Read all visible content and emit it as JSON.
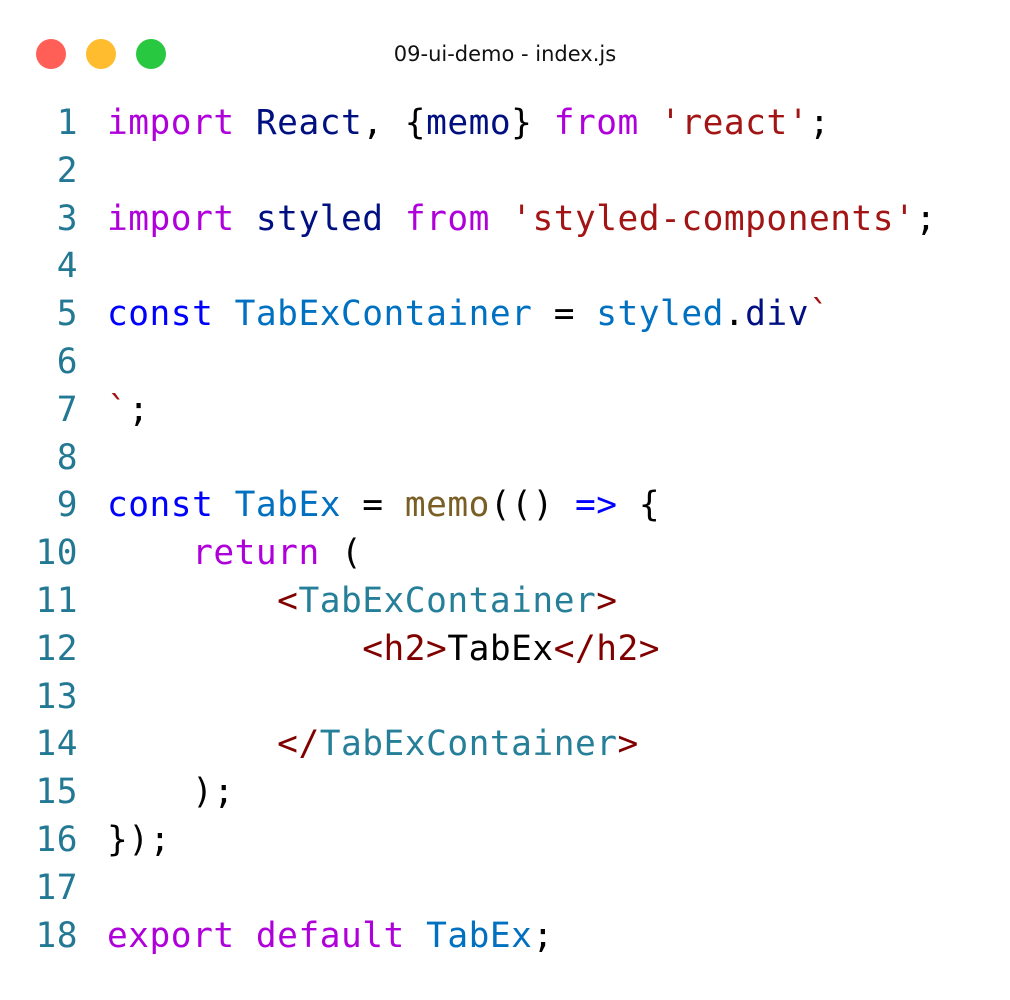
{
  "window": {
    "title": "09-ui-demo - index.js",
    "controls": {
      "close_color": "#ff5f57",
      "minimize_color": "#febc2e",
      "maximize_color": "#28c840"
    }
  },
  "theme": {
    "line_number": "#237893",
    "keyword": "#af00db",
    "storage": "#0000ff",
    "identifier": "#001080",
    "type": "#267f99",
    "string": "#a31515",
    "tag": "#800000",
    "function": "#795e26",
    "property": "#001080",
    "plain": "#000000"
  },
  "editor": {
    "lines": [
      {
        "number": "1",
        "tokens": [
          {
            "text": "import",
            "color": "#af00db"
          },
          {
            "text": " ",
            "color": "#000000"
          },
          {
            "text": "React",
            "color": "#001080"
          },
          {
            "text": ", {",
            "color": "#000000"
          },
          {
            "text": "memo",
            "color": "#001080"
          },
          {
            "text": "} ",
            "color": "#000000"
          },
          {
            "text": "from",
            "color": "#af00db"
          },
          {
            "text": " ",
            "color": "#000000"
          },
          {
            "text": "'react'",
            "color": "#a31515"
          },
          {
            "text": ";",
            "color": "#000000"
          }
        ]
      },
      {
        "number": "2",
        "tokens": []
      },
      {
        "number": "3",
        "tokens": [
          {
            "text": "import",
            "color": "#af00db"
          },
          {
            "text": " ",
            "color": "#000000"
          },
          {
            "text": "styled",
            "color": "#001080"
          },
          {
            "text": " ",
            "color": "#000000"
          },
          {
            "text": "from",
            "color": "#af00db"
          },
          {
            "text": " ",
            "color": "#000000"
          },
          {
            "text": "'styled-components'",
            "color": "#a31515"
          },
          {
            "text": ";",
            "color": "#000000"
          }
        ]
      },
      {
        "number": "4",
        "tokens": []
      },
      {
        "number": "5",
        "tokens": [
          {
            "text": "const",
            "color": "#0000ff"
          },
          {
            "text": " ",
            "color": "#000000"
          },
          {
            "text": "TabExContainer",
            "color": "#0070c1"
          },
          {
            "text": " = ",
            "color": "#000000"
          },
          {
            "text": "styled",
            "color": "#0070c1"
          },
          {
            "text": ".",
            "color": "#000000"
          },
          {
            "text": "div",
            "color": "#001080"
          },
          {
            "text": "`",
            "color": "#a31515"
          }
        ]
      },
      {
        "number": "6",
        "tokens": []
      },
      {
        "number": "7",
        "tokens": [
          {
            "text": "`",
            "color": "#a31515"
          },
          {
            "text": ";",
            "color": "#000000"
          }
        ]
      },
      {
        "number": "8",
        "tokens": []
      },
      {
        "number": "9",
        "tokens": [
          {
            "text": "const",
            "color": "#0000ff"
          },
          {
            "text": " ",
            "color": "#000000"
          },
          {
            "text": "TabEx",
            "color": "#0070c1"
          },
          {
            "text": " = ",
            "color": "#000000"
          },
          {
            "text": "memo",
            "color": "#795e26"
          },
          {
            "text": "(() ",
            "color": "#000000"
          },
          {
            "text": "=>",
            "color": "#0000ff"
          },
          {
            "text": " {",
            "color": "#000000"
          }
        ]
      },
      {
        "number": "10",
        "tokens": [
          {
            "text": "    ",
            "color": "#000000"
          },
          {
            "text": "return",
            "color": "#af00db"
          },
          {
            "text": " (",
            "color": "#000000"
          }
        ]
      },
      {
        "number": "11",
        "tokens": [
          {
            "text": "        ",
            "color": "#000000"
          },
          {
            "text": "<",
            "color": "#800000"
          },
          {
            "text": "TabExContainer",
            "color": "#267f99"
          },
          {
            "text": ">",
            "color": "#800000"
          }
        ]
      },
      {
        "number": "12",
        "tokens": [
          {
            "text": "            ",
            "color": "#000000"
          },
          {
            "text": "<h2>",
            "color": "#800000"
          },
          {
            "text": "TabEx",
            "color": "#000000"
          },
          {
            "text": "</h2>",
            "color": "#800000"
          }
        ]
      },
      {
        "number": "13",
        "tokens": []
      },
      {
        "number": "14",
        "tokens": [
          {
            "text": "        ",
            "color": "#000000"
          },
          {
            "text": "</",
            "color": "#800000"
          },
          {
            "text": "TabExContainer",
            "color": "#267f99"
          },
          {
            "text": ">",
            "color": "#800000"
          }
        ]
      },
      {
        "number": "15",
        "tokens": [
          {
            "text": "    );",
            "color": "#000000"
          }
        ]
      },
      {
        "number": "16",
        "tokens": [
          {
            "text": "});",
            "color": "#000000"
          }
        ]
      },
      {
        "number": "17",
        "tokens": []
      },
      {
        "number": "18",
        "tokens": [
          {
            "text": "export",
            "color": "#af00db"
          },
          {
            "text": " ",
            "color": "#000000"
          },
          {
            "text": "default",
            "color": "#af00db"
          },
          {
            "text": " ",
            "color": "#000000"
          },
          {
            "text": "TabEx",
            "color": "#0070c1"
          },
          {
            "text": ";",
            "color": "#000000"
          }
        ]
      }
    ]
  }
}
